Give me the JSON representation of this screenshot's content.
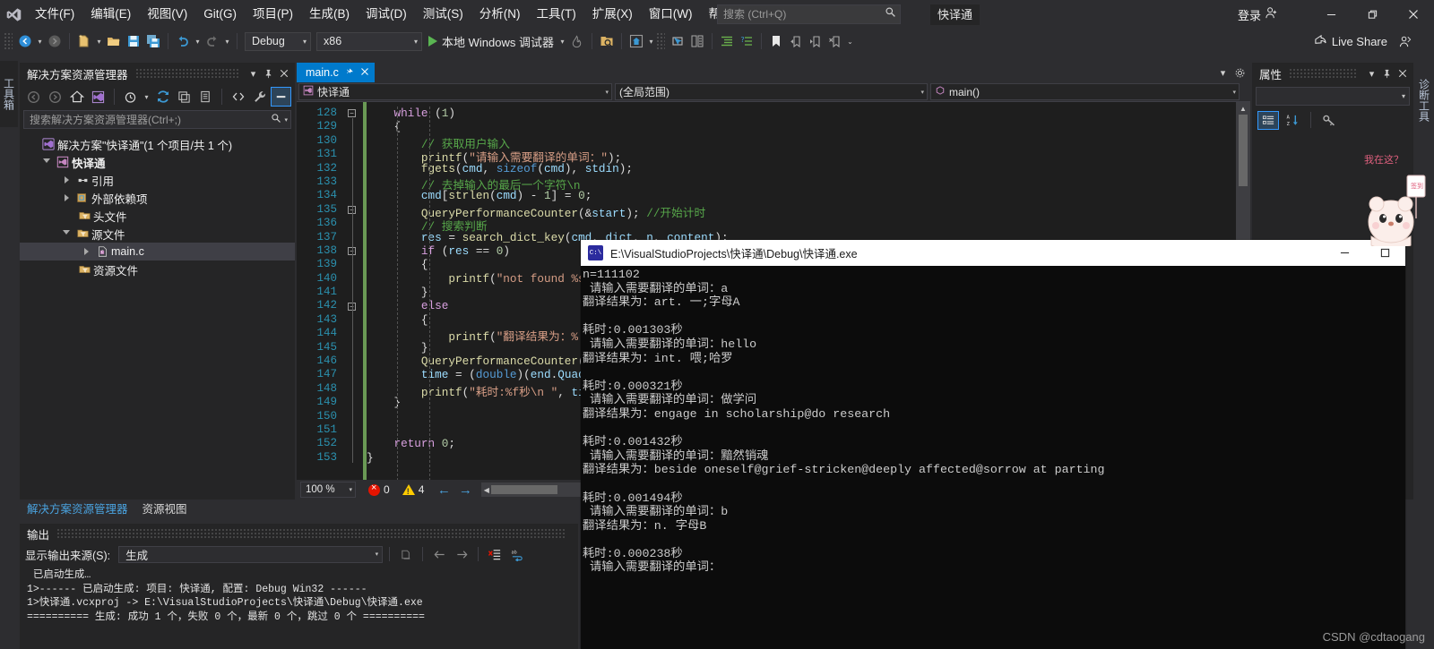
{
  "titlebar": {
    "logo_icon": "visual-studio-logo-icon",
    "menus": [
      "文件(F)",
      "编辑(E)",
      "视图(V)",
      "Git(G)",
      "项目(P)",
      "生成(B)",
      "调试(D)",
      "测试(S)",
      "分析(N)",
      "工具(T)",
      "扩展(X)",
      "窗口(W)",
      "帮助(H)"
    ],
    "search_placeholder": "搜索 (Ctrl+Q)",
    "search_value": "",
    "search_icon": "search-icon",
    "solution_chip": "快译通",
    "account_label": "登录",
    "account_icon": "account-person-icon",
    "minimize_icon": "minimize-icon",
    "restore_icon": "restore-icon",
    "close_icon": "close-icon"
  },
  "toolbar": {
    "back_icon": "navigate-back-icon",
    "forward_icon": "navigate-forward-icon",
    "new_project_icon": "new-project-icon",
    "open_icon": "open-folder-icon",
    "save_icon": "save-icon",
    "save_all_icon": "save-all-icon",
    "undo_icon": "undo-icon",
    "redo_icon": "redo-icon",
    "configuration": "Debug",
    "platform": "x86",
    "run_label": "本地 Windows 调试器",
    "run_icon": "play-triangle-icon",
    "hotreload_icon": "hot-reload-icon",
    "live_share_label": "Live Share",
    "live_share_icon": "live-share-icon",
    "feedback_icon": "send-feedback-icon"
  },
  "left_vertical_tab": "工具箱",
  "right_vertical_tab": "诊断工具",
  "solution_explorer": {
    "title": "解决方案资源管理器",
    "dropdown_icon": "chevron-down-icon",
    "pin_icon": "pin-icon",
    "close_icon": "close-icon",
    "toolbar_icons": [
      "back-icon",
      "forward-icon",
      "home-icon",
      "solution-icon",
      "pending-changes-icon",
      "refresh-icon",
      "collapse-all-icon",
      "properties-page-icon",
      "show-all-files-icon",
      "wrench-icon",
      "view-code-icon"
    ],
    "search_placeholder": "搜索解决方案资源管理器(Ctrl+;)",
    "search_value": "",
    "search_icon": "search-icon",
    "tree": [
      {
        "label": "解决方案\"快译通\"(1 个项目/共 1 个)",
        "icon": "solution-icon",
        "indent": 0,
        "twisty": "none",
        "selected": false
      },
      {
        "label": "快译通",
        "icon": "cpp-project-icon",
        "indent": 1,
        "twisty": "open",
        "selected": false
      },
      {
        "label": "引用",
        "icon": "references-icon",
        "indent": 2,
        "twisty": "closed",
        "selected": false
      },
      {
        "label": "外部依赖项",
        "icon": "external-deps-icon",
        "indent": 2,
        "twisty": "closed",
        "selected": false
      },
      {
        "label": "头文件",
        "icon": "filter-folder-icon",
        "indent": 2,
        "twisty": "none",
        "selected": false
      },
      {
        "label": "源文件",
        "icon": "filter-folder-open-icon",
        "indent": 2,
        "twisty": "open",
        "selected": false
      },
      {
        "label": "main.c",
        "icon": "c-file-icon",
        "indent": 3,
        "twisty": "closed",
        "selected": true
      },
      {
        "label": "资源文件",
        "icon": "filter-folder-icon",
        "indent": 2,
        "twisty": "none",
        "selected": false
      }
    ],
    "bottom_tabs": [
      {
        "label": "解决方案资源管理器",
        "active": true
      },
      {
        "label": "资源视图",
        "active": false
      }
    ]
  },
  "editor": {
    "tab_label": "main.c",
    "tab_pin_icon": "pin-icon",
    "tab_close_icon": "close-icon",
    "tabstrip_dropdown_icon": "chevron-down-icon",
    "tabstrip_settings_icon": "gear-icon",
    "nav_project": "快译通",
    "nav_project_icon": "cpp-project-icon",
    "nav_scope": "(全局范围)",
    "nav_member": "main()",
    "nav_member_icon": "method-icon",
    "first_line": 128,
    "lines": [
      {
        "n": 128,
        "fold": "minus",
        "code": "    while (1)"
      },
      {
        "n": 129,
        "fold": "",
        "code": "    {"
      },
      {
        "n": 130,
        "fold": "",
        "code": "        // 获取用户输入"
      },
      {
        "n": 131,
        "fold": "",
        "code": "        printf(\"请输入需要翻译的单词：\");"
      },
      {
        "n": 132,
        "fold": "",
        "code": "        fgets(cmd, sizeof(cmd), stdin);"
      },
      {
        "n": 133,
        "fold": "",
        "code": "        // 去掉输入的最后一个字符\\n"
      },
      {
        "n": 134,
        "fold": "",
        "code": "        cmd[strlen(cmd) - 1] = 0;"
      },
      {
        "n": 135,
        "fold": "minus",
        "code": "        QueryPerformanceCounter(&start); //开始计时"
      },
      {
        "n": 136,
        "fold": "",
        "code": "        // 搜索判断"
      },
      {
        "n": 137,
        "fold": "",
        "code": "        res = search_dict_key(cmd, dict, n, content);"
      },
      {
        "n": 138,
        "fold": "minus",
        "code": "        if (res == 0)"
      },
      {
        "n": 139,
        "fold": "",
        "code": "        {"
      },
      {
        "n": 140,
        "fold": "",
        "code": "            printf(\"not found %s"
      },
      {
        "n": 141,
        "fold": "",
        "code": "        }"
      },
      {
        "n": 142,
        "fold": "minus",
        "code": "        else"
      },
      {
        "n": 143,
        "fold": "",
        "code": "        {"
      },
      {
        "n": 144,
        "fold": "",
        "code": "            printf(\"翻译结果为：%"
      },
      {
        "n": 145,
        "fold": "",
        "code": "        }"
      },
      {
        "n": 146,
        "fold": "",
        "code": "        QueryPerformanceCounter(&"
      },
      {
        "n": 147,
        "fold": "",
        "code": "        time = (double)(end.QuadP"
      },
      {
        "n": 148,
        "fold": "",
        "code": "        printf(\"耗时:%f秒\\n \", ti"
      },
      {
        "n": 149,
        "fold": "",
        "code": "    }"
      },
      {
        "n": 150,
        "fold": "",
        "code": ""
      },
      {
        "n": 151,
        "fold": "",
        "code": ""
      },
      {
        "n": 152,
        "fold": "",
        "code": "    return 0;"
      },
      {
        "n": 153,
        "fold": "",
        "code": "}"
      }
    ],
    "status": {
      "zoom": "100 %",
      "zoom_caret_icon": "chevron-down-icon",
      "error_count": "0",
      "error_icon": "error-circle-icon",
      "warning_count": "4",
      "warning_icon": "warning-triangle-icon",
      "prev_icon": "arrow-left-icon",
      "next_icon": "arrow-right-icon"
    }
  },
  "properties": {
    "title": "属性",
    "dropdown_icon": "chevron-down-icon",
    "pin_icon": "pin-icon",
    "close_icon": "close-icon",
    "object_combo_value": "",
    "object_combo_caret_icon": "chevron-down-icon",
    "toolbar_icons": [
      "categorized-view-icon",
      "alphabetical-sort-icon",
      "property-pages-key-icon"
    ]
  },
  "output": {
    "title": "输出",
    "source_label": "显示输出来源(S):",
    "source_value": "生成",
    "source_caret_icon": "chevron-down-icon",
    "toolbar_icons": [
      "find-message-icon",
      "go-to-previous-icon",
      "go-to-next-icon",
      "clear-all-icon",
      "toggle-word-wrap-icon"
    ],
    "lines": [
      " 已启动生成…",
      "1>------ 已启动生成: 项目: 快译通, 配置: Debug Win32 ------",
      "1>快译通.vcxproj -> E:\\VisualStudioProjects\\快译通\\Debug\\快译通.exe",
      "========== 生成: 成功 1 个，失败 0 个，最新 0 个，跳过 0 个 =========="
    ]
  },
  "console": {
    "title": "E:\\VisualStudioProjects\\快译通\\Debug\\快译通.exe",
    "title_icon": "cmd-console-icon",
    "minimize_icon": "minimize-icon",
    "maximize_icon": "maximize-icon",
    "lines": [
      "n=111102",
      " 请输入需要翻译的单词：a",
      "翻译结果为：art. 一;字母A",
      "",
      "耗时:0.001303秒",
      " 请输入需要翻译的单词：hello",
      "翻译结果为：int. 喂;哈罗",
      "",
      "耗时:0.000321秒",
      " 请输入需要翻译的单词：做学问",
      "翻译结果为：engage in scholarship@do research",
      "",
      "耗时:0.001432秒",
      " 请输入需要翻译的单词：黯然销魂",
      "翻译结果为：beside oneself@grief-stricken@deeply affected@sorrow at parting",
      "",
      "耗时:0.001494秒",
      " 请输入需要翻译的单词：b",
      "翻译结果为：n. 字母B",
      "",
      "耗时:0.000238秒",
      " 请输入需要翻译的单词："
    ]
  },
  "mascot": {
    "bubble_text": "我在这？",
    "icon": "cartoon-bear-icon"
  },
  "watermark": "CSDN @cdtaogang",
  "colors": {
    "accent": "#007acc",
    "chrome_bg": "#2d2d30",
    "panel_bg": "#252526",
    "editor_bg": "#1e1e1e",
    "linenum": "#2b91af",
    "comment": "#57a64a",
    "string": "#d69d85",
    "keyword": "#d8a0df",
    "console_bg": "#0c0c0c"
  }
}
